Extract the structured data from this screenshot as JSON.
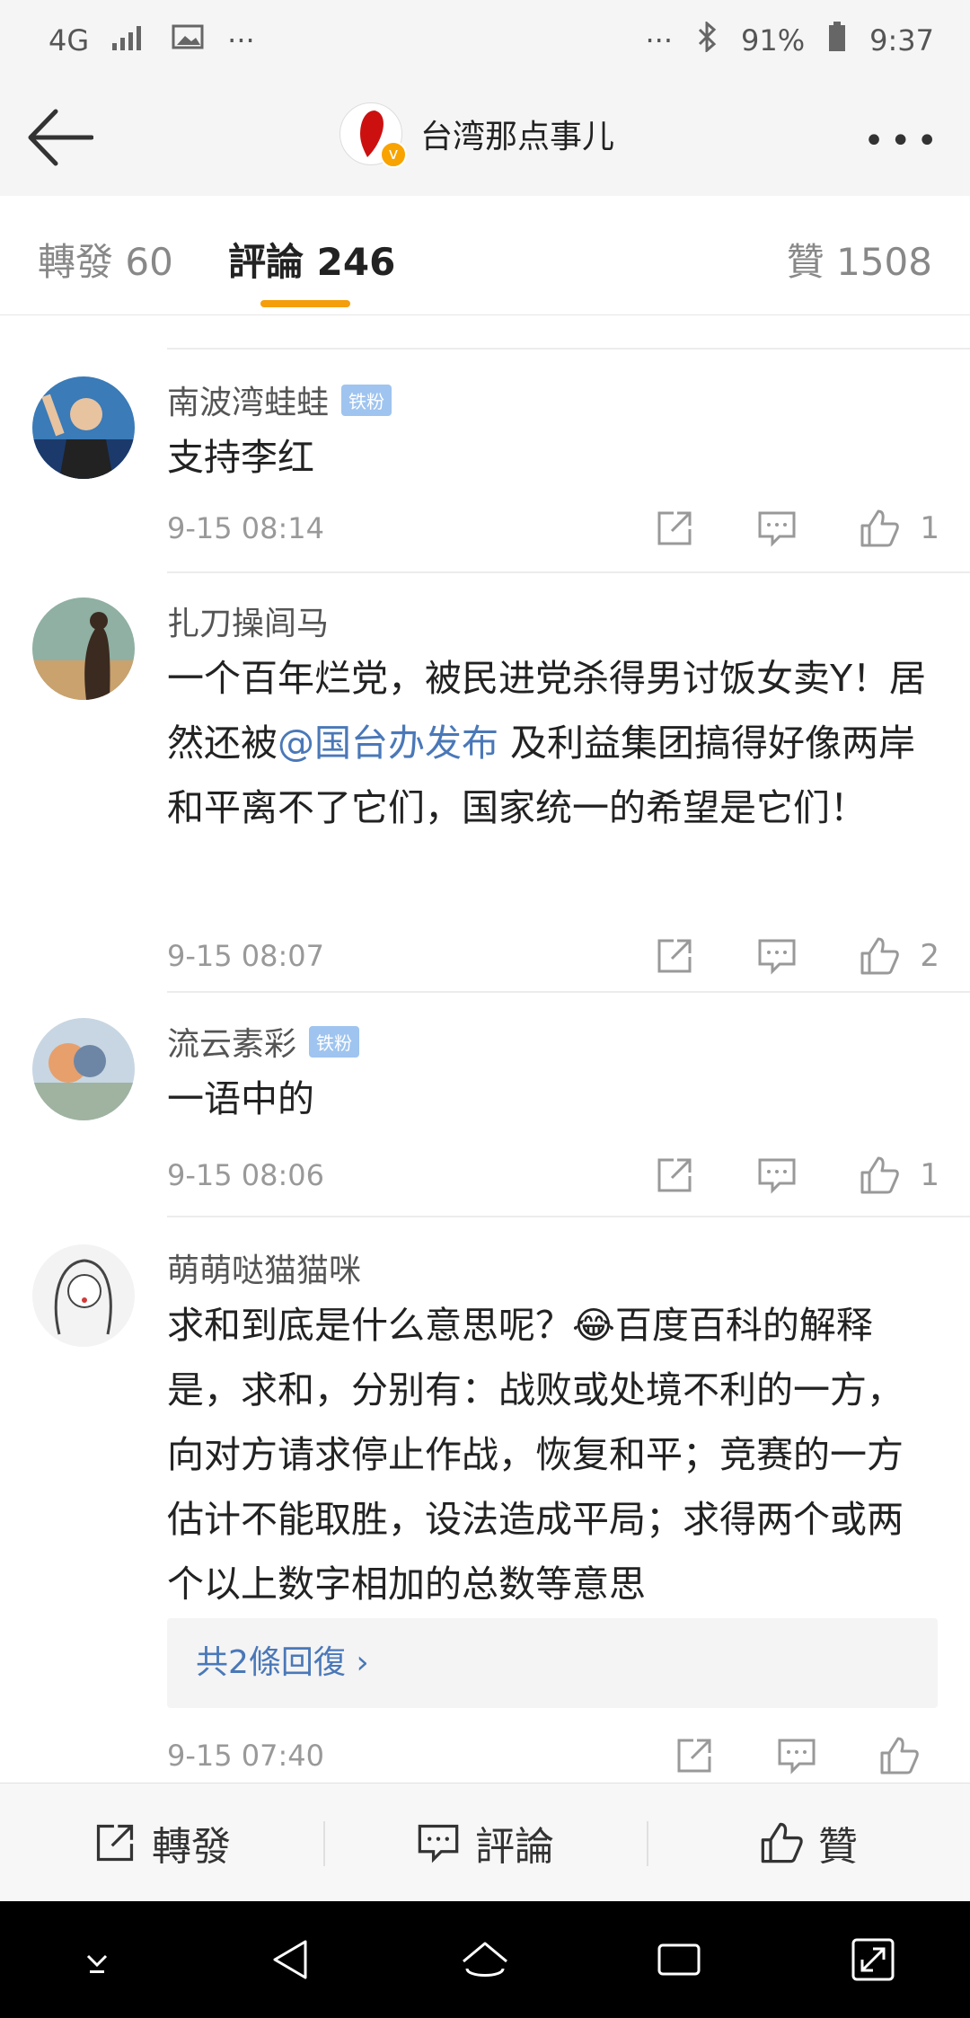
{
  "status_bar": {
    "network": "4G",
    "battery": "91%",
    "time": "9:37",
    "dots_left": "···",
    "dots_right": "···"
  },
  "header": {
    "title": "台湾那点事儿",
    "more": "•••"
  },
  "tabs": [
    {
      "label": "轉發 60"
    },
    {
      "label": "評論 246"
    },
    {
      "label": "贊 1508"
    }
  ],
  "comments": [
    {
      "user": "南波湾蛙蛙",
      "badge": "铁粉",
      "text": "支持李红",
      "time": "9-15 08:14",
      "likes": "1"
    },
    {
      "user": "扎刀操闾马",
      "badge": "",
      "text_before": "一个百年烂党，被民进党杀得男讨饭女卖Y！居然还被",
      "mention": "@国台办发布",
      "text_after": " 及利益集团搞得好像两岸和平离不了它们，国家统一的希望是它们！",
      "time": "9-15 08:07",
      "likes": "2"
    },
    {
      "user": "流云素彩",
      "badge": "铁粉",
      "text": "一语中的",
      "time": "9-15 08:06",
      "likes": "1"
    },
    {
      "user": "萌萌哒猫猫咪",
      "badge": "",
      "text_before": "求和到底是什么意思呢？",
      "emoji": "😂",
      "text_after": "百度百科的解释是，求和，分别有：战败或处境不利的一方，向对方请求停止作战，恢复和平；竞赛的一方估计不能取胜，设法造成平局；求得两个或两个以上数字相加的总数等意思",
      "replies": "共2條回復 ›",
      "time": "9-15 07:40",
      "likes": ""
    }
  ],
  "bottom_bar": {
    "repost": "轉發",
    "comment": "評論",
    "like": "贊"
  },
  "colors": {
    "accent": "#f59e0b",
    "link": "#4a78b8",
    "badge": "#9fc4ef"
  }
}
